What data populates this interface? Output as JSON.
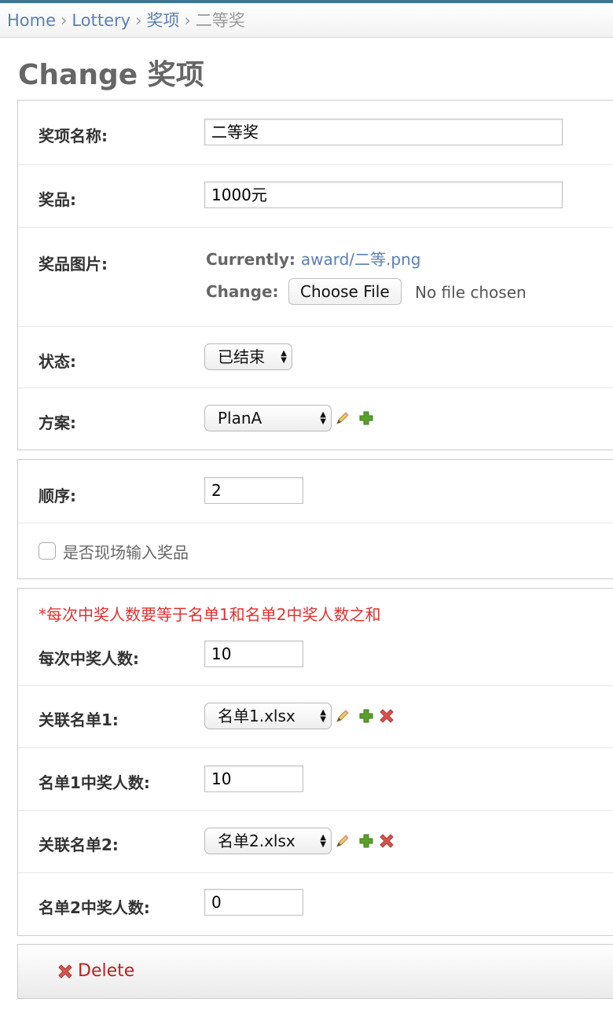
{
  "breadcrumbs": {
    "home": "Home",
    "app": "Lottery",
    "model": "奖项",
    "current": "二等奖",
    "separator": "›"
  },
  "page_title": "Change 奖项",
  "section1": {
    "name_label": "奖项名称:",
    "name_value": "二等奖",
    "prize_label": "奖品:",
    "prize_value": "1000元",
    "image_label": "奖品图片:",
    "currently_label": "Currently:",
    "currently_link": "award/二等.png",
    "change_label": "Change:",
    "choose_file": "Choose File",
    "no_file": "No file chosen",
    "status_label": "状态:",
    "status_value": "已结束",
    "plan_label": "方案:",
    "plan_value": "PlanA"
  },
  "section2": {
    "order_label": "顺序:",
    "order_value": "2",
    "checkbox_label": "是否现场输入奖品",
    "checkbox_checked": false
  },
  "section3": {
    "note": "*每次中奖人数要等于名单1和名单2中奖人数之和",
    "per_draw_label": "每次中奖人数:",
    "per_draw_value": "10",
    "list1_label": "关联名单1:",
    "list1_value": "名单1.xlsx",
    "list1_count_label": "名单1中奖人数:",
    "list1_count_value": "10",
    "list2_label": "关联名单2:",
    "list2_value": "名单2.xlsx",
    "list2_count_label": "名单2中奖人数:",
    "list2_count_value": "0"
  },
  "actions": {
    "delete_label": "Delete"
  },
  "colors": {
    "link": "#5b80b2",
    "delete": "#ba2121",
    "note": "#e03131",
    "topbar": "#417690"
  },
  "icons": [
    "pencil-icon",
    "plus-icon",
    "delete-x-icon",
    "select-arrows-icon"
  ]
}
